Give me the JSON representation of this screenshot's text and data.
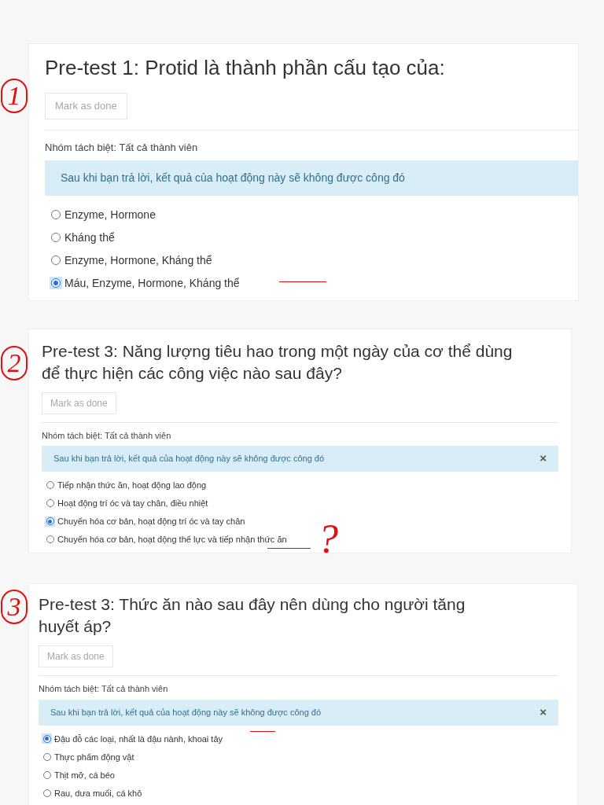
{
  "questions": [
    {
      "title": "Pre-test 1: Protid là thành phần cấu tạo của:",
      "button": "Mark as done",
      "group_label": "Nhóm tách biệt: Tất cả thành viên",
      "notice": "Sau khi bạn trả lời, kết quả của hoạt động này sẽ không được công đó",
      "options": [
        {
          "label": "Enzyme, Hormone",
          "selected": false
        },
        {
          "label": "Kháng thể",
          "selected": false
        },
        {
          "label": "Enzyme, Hormone, Kháng thể",
          "selected": false
        },
        {
          "label": "Máu, Enzyme, Hormone, Kháng thể",
          "selected": true
        }
      ]
    },
    {
      "title": "Pre-test 3: Năng lượng tiêu hao trong một ngày của cơ thể dùng để thực hiện các công việc nào sau đây?",
      "button": "Mark as done",
      "group_label": "Nhóm tách biệt: Tất cả thành viên",
      "notice": "Sau khi bạn trả lời, kết quả của hoạt động này sẽ không được công đó",
      "close": "×",
      "options": [
        {
          "label": "Tiếp nhận thức ăn, hoạt động lao động",
          "selected": false
        },
        {
          "label": "Hoạt động trí óc và tay chân, điều nhiệt",
          "selected": false
        },
        {
          "label": "Chuyển hóa cơ bản, hoạt động trí óc và tay chân",
          "selected": true
        },
        {
          "label": "Chuyển hóa cơ bản, hoạt động thể lực và tiếp nhận thức ăn",
          "selected": false
        }
      ]
    },
    {
      "title": "Pre-test 3: Thức ăn nào sau đây nên dùng cho người tăng huyết áp?",
      "button": "Mark as done",
      "group_label": "Nhóm tách biệt: Tất cả thành viên",
      "notice": "Sau khi bạn trả lời, kết quả của hoạt động này sẽ không được công đó",
      "close": "×",
      "options": [
        {
          "label": "Đậu đỗ các loại, nhất là đậu nành, khoai tây",
          "selected": true
        },
        {
          "label": "Thực phẩm động vật",
          "selected": false
        },
        {
          "label": "Thịt mỡ, cá béo",
          "selected": false
        },
        {
          "label": "Rau, dưa muối, cá khô",
          "selected": false
        }
      ]
    }
  ],
  "annotations": [
    {
      "text": "1"
    },
    {
      "text": "2"
    },
    {
      "text": "?"
    },
    {
      "text": "3"
    }
  ]
}
